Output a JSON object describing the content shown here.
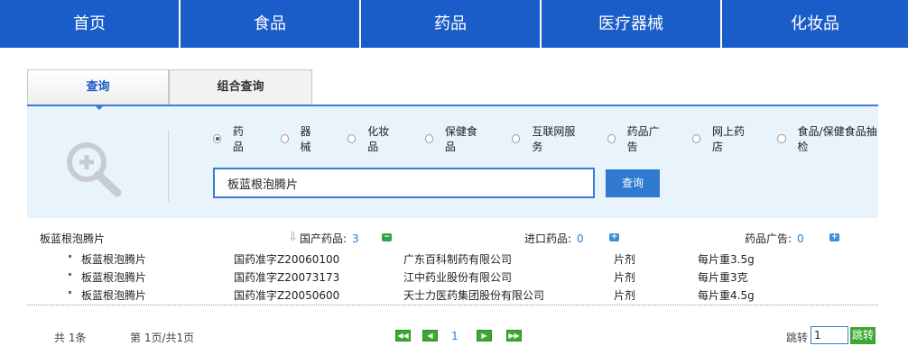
{
  "nav": [
    "首页",
    "食品",
    "药品",
    "医疗器械",
    "化妆品"
  ],
  "tabs": {
    "active": "查询",
    "other": "组合查询"
  },
  "search": {
    "radios": [
      "药品",
      "器械",
      "化妆品",
      "保健食品",
      "互联网服务",
      "药品广告",
      "网上药店",
      "食品/保健食品抽检"
    ],
    "selected_radio": "药品",
    "value": "板蓝根泡腾片",
    "button": "查询"
  },
  "results": {
    "title": "板蓝根泡腾片",
    "domestic_label": "国产药品:",
    "domestic_count": "3",
    "import_label": "进口药品:",
    "import_count": "0",
    "ad_label": "药品广告:",
    "ad_count": "0",
    "rows": [
      {
        "name": "板蓝根泡腾片",
        "approval": "国药准字Z20060100",
        "company": "广东百科制药有限公司",
        "form": "片剂",
        "spec": "每片重3.5g"
      },
      {
        "name": "板蓝根泡腾片",
        "approval": "国药准字Z20073173",
        "company": "江中药业股份有限公司",
        "form": "片剂",
        "spec": "每片重3克"
      },
      {
        "name": "板蓝根泡腾片",
        "approval": "国药准字Z20050600",
        "company": "天士力医药集团股份有限公司",
        "form": "片剂",
        "spec": "每片重4.5g"
      }
    ]
  },
  "pager": {
    "total": "共 1条",
    "pages": "第 1页/共1页",
    "current": "1",
    "jump_label": "跳转",
    "jump_value": "1",
    "jump_button": "跳转"
  },
  "icons": [
    "magnifier-plus-icon",
    "down-arrow-icon",
    "minus-icon",
    "plus-icon",
    "first-page-icon",
    "prev-page-icon",
    "next-page-icon",
    "last-page-icon"
  ],
  "colors": {
    "nav_blue": "#1a5cc8",
    "accent": "#3a7bd5",
    "panel_bg": "#e9f3fb",
    "green": "#3ca832"
  }
}
